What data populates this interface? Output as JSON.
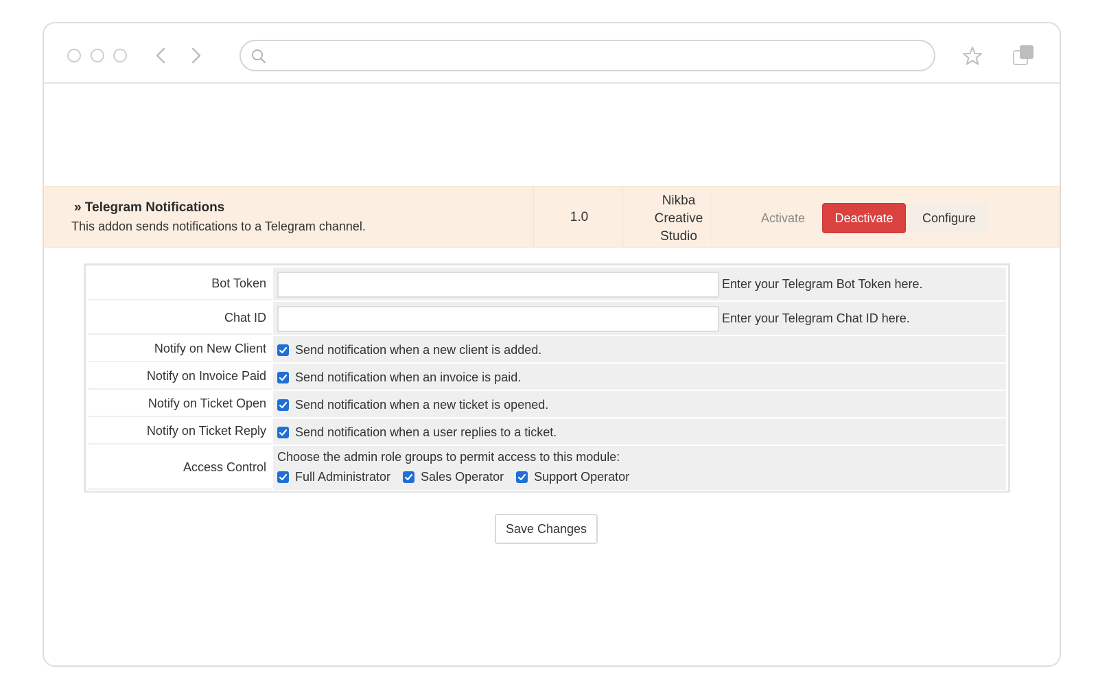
{
  "browser": {
    "address_value": "",
    "icons": [
      "search-icon",
      "back-arrow-icon",
      "forward-arrow-icon",
      "star-icon",
      "tabs-icon"
    ]
  },
  "addon": {
    "title": "» Telegram Notifications",
    "description": "This addon sends notifications to a Telegram channel.",
    "version": "1.0",
    "author": "Nikba\nCreative\nStudio",
    "activate_label": "Activate",
    "deactivate_label": "Deactivate",
    "configure_label": "Configure"
  },
  "settings": {
    "bot_token": {
      "label": "Bot Token",
      "value": "",
      "hint": "Enter your Telegram Bot Token here."
    },
    "chat_id": {
      "label": "Chat ID",
      "value": "",
      "hint": "Enter your Telegram Chat ID here."
    },
    "notify_new_client": {
      "label": "Notify on New Client",
      "checked": true,
      "text": "Send notification when a new client is added."
    },
    "notify_invoice_paid": {
      "label": "Notify on Invoice Paid",
      "checked": true,
      "text": "Send notification when an invoice is paid."
    },
    "notify_ticket_open": {
      "label": "Notify on Ticket Open",
      "checked": true,
      "text": "Send notification when a new ticket is opened."
    },
    "notify_ticket_reply": {
      "label": "Notify on Ticket Reply",
      "checked": true,
      "text": "Send notification when a user replies to a ticket."
    },
    "access_control": {
      "label": "Access Control",
      "text": "Choose the admin role groups to permit access to this module:",
      "options": [
        {
          "label": "Full Administrator",
          "checked": true
        },
        {
          "label": "Sales Operator",
          "checked": true
        },
        {
          "label": "Support Operator",
          "checked": true
        }
      ]
    }
  },
  "save_label": "Save Changes",
  "colors": {
    "accent_checkbox": "#1f6fd6",
    "deactivate": "#d9423f",
    "addon_row_bg": "#fcefe2"
  }
}
